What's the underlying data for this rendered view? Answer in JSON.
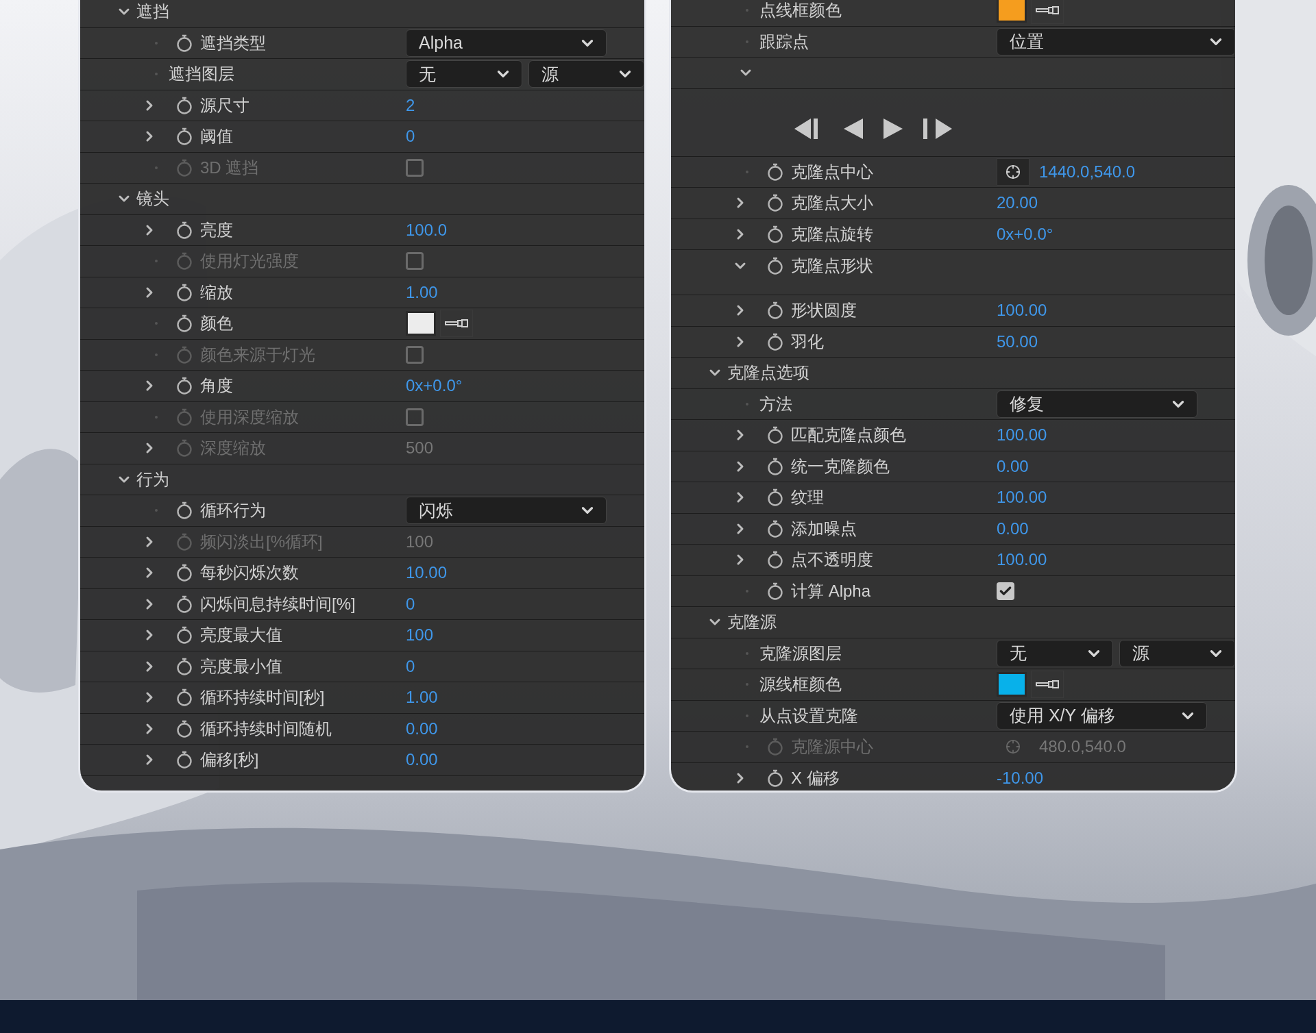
{
  "panels": [
    {
      "rows": [
        {
          "kind": "section",
          "label": "遮挡",
          "expanded": true
        },
        {
          "kind": "property",
          "label": "遮挡类型",
          "expandable": false,
          "stopwatch": true,
          "disabled": false,
          "control": {
            "kind": "dropdown",
            "text": "Alpha"
          }
        },
        {
          "kind": "property",
          "label": "遮挡图层",
          "expandable": false,
          "stopwatch": false,
          "disabled": false,
          "control": {
            "kind": "dropdown_pair",
            "texts": [
              "无",
              "源"
            ]
          }
        },
        {
          "kind": "property",
          "label": "源尺寸",
          "expandable": true,
          "expanded": false,
          "stopwatch": true,
          "disabled": false,
          "control": {
            "kind": "value",
            "text": "2"
          }
        },
        {
          "kind": "property",
          "label": "阈值",
          "expandable": true,
          "expanded": false,
          "stopwatch": true,
          "disabled": false,
          "control": {
            "kind": "value",
            "text": "0"
          }
        },
        {
          "kind": "property",
          "label": "3D 遮挡",
          "expandable": false,
          "stopwatch": true,
          "disabled": true,
          "control": {
            "kind": "checkbox",
            "checked": false
          }
        },
        {
          "kind": "section",
          "label": "镜头",
          "expanded": true
        },
        {
          "kind": "property",
          "label": "亮度",
          "expandable": true,
          "expanded": false,
          "stopwatch": true,
          "disabled": false,
          "control": {
            "kind": "value",
            "text": "100.0"
          }
        },
        {
          "kind": "property",
          "label": "使用灯光强度",
          "expandable": false,
          "stopwatch": true,
          "disabled": true,
          "control": {
            "kind": "checkbox",
            "checked": false
          }
        },
        {
          "kind": "property",
          "label": "缩放",
          "expandable": true,
          "expanded": false,
          "stopwatch": true,
          "disabled": false,
          "control": {
            "kind": "value",
            "text": "1.00"
          }
        },
        {
          "kind": "property",
          "label": "颜色",
          "expandable": false,
          "stopwatch": true,
          "disabled": false,
          "control": {
            "kind": "color",
            "color": "#ececec"
          }
        },
        {
          "kind": "property",
          "label": "颜色来源于灯光",
          "expandable": false,
          "stopwatch": true,
          "disabled": true,
          "control": {
            "kind": "checkbox",
            "checked": false
          }
        },
        {
          "kind": "property",
          "label": "角度",
          "expandable": true,
          "expanded": false,
          "stopwatch": true,
          "disabled": false,
          "control": {
            "kind": "value",
            "text": "0x+0.0°"
          }
        },
        {
          "kind": "property",
          "label": "使用深度缩放",
          "expandable": false,
          "stopwatch": true,
          "disabled": true,
          "control": {
            "kind": "checkbox",
            "checked": false
          }
        },
        {
          "kind": "property",
          "label": "深度缩放",
          "expandable": true,
          "expanded": false,
          "stopwatch": true,
          "disabled": true,
          "control": {
            "kind": "value",
            "text": "500"
          }
        },
        {
          "kind": "section",
          "label": "行为",
          "expanded": true
        },
        {
          "kind": "property",
          "label": "循环行为",
          "expandable": false,
          "stopwatch": true,
          "disabled": false,
          "control": {
            "kind": "dropdown",
            "text": "闪烁"
          }
        },
        {
          "kind": "property",
          "label": "频闪淡出[%循环]",
          "expandable": true,
          "expanded": false,
          "stopwatch": true,
          "disabled": true,
          "control": {
            "kind": "value",
            "text": "100"
          }
        },
        {
          "kind": "property",
          "label": "每秒闪烁次数",
          "expandable": true,
          "expanded": false,
          "stopwatch": true,
          "disabled": false,
          "control": {
            "kind": "value",
            "text": "10.00"
          }
        },
        {
          "kind": "property",
          "label": "闪烁间息持续时间[%]",
          "expandable": true,
          "expanded": false,
          "stopwatch": true,
          "disabled": false,
          "control": {
            "kind": "value",
            "text": "0"
          }
        },
        {
          "kind": "property",
          "label": "亮度最大值",
          "expandable": true,
          "expanded": false,
          "stopwatch": true,
          "disabled": false,
          "control": {
            "kind": "value",
            "text": "100"
          }
        },
        {
          "kind": "property",
          "label": "亮度最小值",
          "expandable": true,
          "expanded": false,
          "stopwatch": true,
          "disabled": false,
          "control": {
            "kind": "value",
            "text": "0"
          }
        },
        {
          "kind": "property",
          "label": "循环持续时间[秒]",
          "expandable": true,
          "expanded": false,
          "stopwatch": true,
          "disabled": false,
          "control": {
            "kind": "value",
            "text": "1.00"
          }
        },
        {
          "kind": "property",
          "label": "循环持续时间随机",
          "expandable": true,
          "expanded": false,
          "stopwatch": true,
          "disabled": false,
          "control": {
            "kind": "value",
            "text": "0.00"
          }
        },
        {
          "kind": "property",
          "label": "偏移[秒]",
          "expandable": true,
          "expanded": false,
          "stopwatch": true,
          "disabled": false,
          "control": {
            "kind": "value",
            "text": "0.00"
          }
        }
      ]
    },
    {
      "rows": [
        {
          "kind": "property",
          "label": "点线框颜色",
          "expandable": false,
          "stopwatch": false,
          "disabled": false,
          "control": {
            "kind": "color",
            "color": "#f59d1e"
          }
        },
        {
          "kind": "property",
          "label": "跟踪点",
          "expandable": false,
          "stopwatch": false,
          "disabled": false,
          "control": {
            "kind": "dropdown",
            "text": "位置",
            "wide": true
          }
        },
        {
          "kind": "group",
          "expanded": true
        },
        {
          "kind": "transport"
        },
        {
          "kind": "property",
          "label": "克隆点中心",
          "expandable": false,
          "stopwatch": true,
          "disabled": false,
          "control": {
            "kind": "point",
            "text": "1440.0,540.0"
          }
        },
        {
          "kind": "property",
          "label": "克隆点大小",
          "expandable": true,
          "expanded": false,
          "stopwatch": true,
          "disabled": false,
          "control": {
            "kind": "value",
            "text": "20.00"
          }
        },
        {
          "kind": "property",
          "label": "克隆点旋转",
          "expandable": true,
          "expanded": false,
          "stopwatch": true,
          "disabled": false,
          "control": {
            "kind": "value",
            "text": "0x+0.0°"
          }
        },
        {
          "kind": "property",
          "label": "克隆点形状",
          "expandable": true,
          "expanded": true,
          "stopwatch": true,
          "disabled": false
        },
        {
          "kind": "property",
          "label": "形状圆度",
          "expandable": true,
          "expanded": false,
          "stopwatch": true,
          "disabled": false,
          "control": {
            "kind": "value",
            "text": "100.00"
          }
        },
        {
          "kind": "property",
          "label": "羽化",
          "expandable": true,
          "expanded": false,
          "stopwatch": true,
          "disabled": false,
          "control": {
            "kind": "value",
            "text": "50.00"
          }
        },
        {
          "kind": "section",
          "label": "克隆点选项",
          "expanded": true
        },
        {
          "kind": "property",
          "label": "方法",
          "expandable": false,
          "stopwatch": false,
          "disabled": false,
          "control": {
            "kind": "dropdown",
            "text": "修复"
          }
        },
        {
          "kind": "property",
          "label": "匹配克隆点颜色",
          "expandable": true,
          "expanded": false,
          "stopwatch": true,
          "disabled": false,
          "control": {
            "kind": "value",
            "text": "100.00"
          }
        },
        {
          "kind": "property",
          "label": "统一克隆颜色",
          "expandable": true,
          "expanded": false,
          "stopwatch": true,
          "disabled": false,
          "control": {
            "kind": "value",
            "text": "0.00"
          }
        },
        {
          "kind": "property",
          "label": "纹理",
          "expandable": true,
          "expanded": false,
          "stopwatch": true,
          "disabled": false,
          "control": {
            "kind": "value",
            "text": "100.00"
          }
        },
        {
          "kind": "property",
          "label": "添加噪点",
          "expandable": true,
          "expanded": false,
          "stopwatch": true,
          "disabled": false,
          "control": {
            "kind": "value",
            "text": "0.00"
          }
        },
        {
          "kind": "property",
          "label": "点不透明度",
          "expandable": true,
          "expanded": false,
          "stopwatch": true,
          "disabled": false,
          "control": {
            "kind": "value",
            "text": "100.00"
          }
        },
        {
          "kind": "property",
          "label": "计算 Alpha",
          "expandable": false,
          "stopwatch": true,
          "disabled": false,
          "control": {
            "kind": "checkbox",
            "checked": true
          }
        },
        {
          "kind": "section",
          "label": "克隆源",
          "expanded": true
        },
        {
          "kind": "property",
          "label": "克隆源图层",
          "expandable": false,
          "stopwatch": false,
          "disabled": false,
          "control": {
            "kind": "dropdown_pair",
            "texts": [
              "无",
              "源"
            ]
          }
        },
        {
          "kind": "property",
          "label": "源线框颜色",
          "expandable": false,
          "stopwatch": false,
          "disabled": false,
          "control": {
            "kind": "color",
            "color": "#08b1ea"
          }
        },
        {
          "kind": "property",
          "label": "从点设置克隆",
          "expandable": false,
          "stopwatch": false,
          "disabled": false,
          "control": {
            "kind": "dropdown",
            "text": "使用 X/Y 偏移",
            "wide": false
          }
        },
        {
          "kind": "property",
          "label": "克隆源中心",
          "expandable": false,
          "stopwatch": true,
          "disabled": true,
          "control": {
            "kind": "point",
            "text": "480.0,540.0"
          }
        },
        {
          "kind": "property",
          "label": "X 偏移",
          "expandable": true,
          "expanded": false,
          "stopwatch": true,
          "disabled": false,
          "control": {
            "kind": "value",
            "text": "-10.00"
          }
        }
      ]
    }
  ]
}
